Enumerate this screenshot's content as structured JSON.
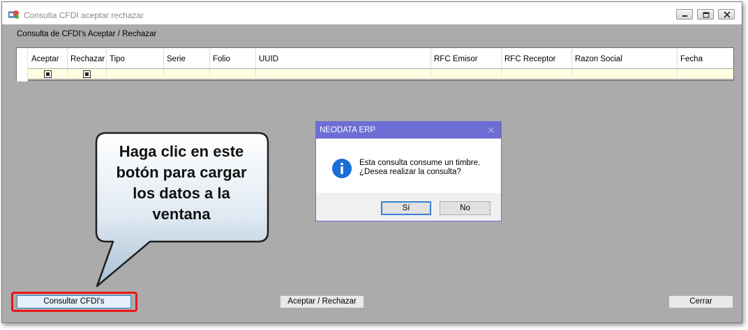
{
  "window": {
    "title": "Consulta CFDI aceptar rechazar",
    "section_label": "Consulta de CFDI's Aceptar / Rechazar"
  },
  "grid": {
    "columns": [
      "Aceptar",
      "Rechazar",
      "Tipo",
      "Serie",
      "Folio",
      "UUID",
      "RFC Emisor",
      "RFC Receptor",
      "Razon Social",
      "Fecha"
    ]
  },
  "dialog": {
    "title": "NEODATA ERP",
    "message_line1": "Esta consulta consume un timbre.",
    "message_line2": "¿Desea realizar la consulta?",
    "yes_label": "Sí",
    "no_label": "No",
    "icon": "info-icon"
  },
  "callout": {
    "lines": [
      "Haga clic en este",
      "botón para cargar",
      "los datos a la",
      "ventana"
    ]
  },
  "buttons": {
    "consultar": "Consultar CFDI's",
    "aceptar_rechazar": "Aceptar / Rechazar",
    "cerrar": "Cerrar"
  },
  "colors": {
    "dialog_title": "#6d6dd4",
    "highlight": "#e81818",
    "row_bg": "#fffde1"
  }
}
